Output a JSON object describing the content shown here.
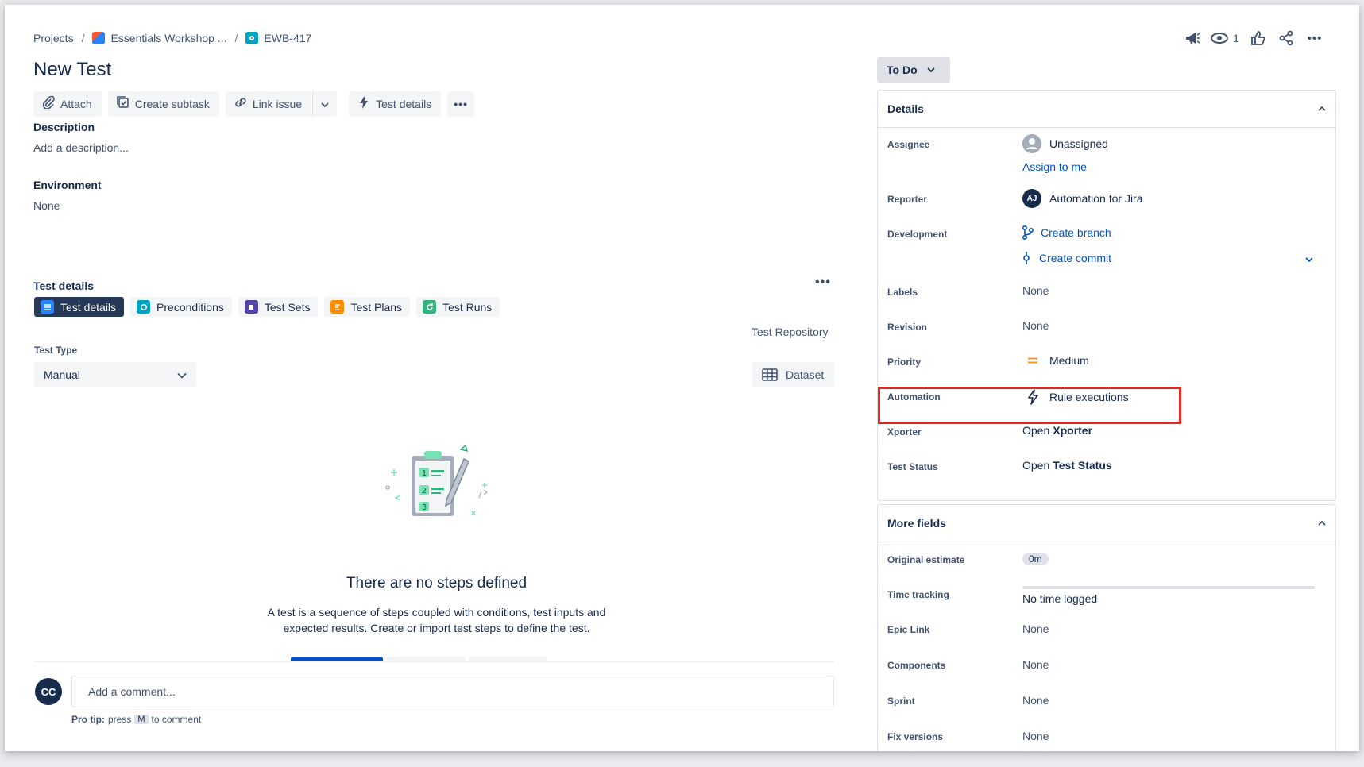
{
  "breadcrumb": {
    "root": "Projects",
    "project": "Essentials Workshop ...",
    "issue_key": "EWB-417",
    "sep": "/"
  },
  "title": "New Test",
  "toolbar": {
    "attach": "Attach",
    "create_subtask": "Create subtask",
    "link_issue": "Link issue",
    "test_details": "Test details"
  },
  "description": {
    "heading": "Description",
    "placeholder": "Add a description..."
  },
  "environment": {
    "heading": "Environment",
    "value": "None"
  },
  "test_details": {
    "heading": "Test details",
    "tabs": [
      "Test details",
      "Preconditions",
      "Test Sets",
      "Test Plans",
      "Test Runs"
    ],
    "repository_label": "Test Repository",
    "test_type_label": "Test Type",
    "test_type_value": "Manual",
    "dataset_label": "Dataset",
    "empty_title": "There are no steps defined",
    "empty_desc_line1": "A test is a sequence of steps coupled with conditions, test inputs and",
    "empty_desc_line2": "expected results. Create or import test steps to define the test."
  },
  "comment": {
    "avatar": "CC",
    "placeholder": "Add a comment...",
    "protip_label": "Pro tip:",
    "protip_press": "press",
    "protip_key": "M",
    "protip_suffix": "to comment"
  },
  "header_actions": {
    "watch_count": "1"
  },
  "status": "To Do",
  "details": {
    "heading": "Details",
    "assignee_label": "Assignee",
    "assignee_value": "Unassigned",
    "assign_to_me": "Assign to me",
    "reporter_label": "Reporter",
    "reporter_initials": "AJ",
    "reporter_value": "Automation for Jira",
    "development_label": "Development",
    "create_branch": "Create branch",
    "create_commit": "Create commit",
    "labels_label": "Labels",
    "labels_value": "None",
    "revision_label": "Revision",
    "revision_value": "None",
    "priority_label": "Priority",
    "priority_value": "Medium",
    "automation_label": "Automation",
    "automation_value": "Rule executions",
    "xporter_label": "Xporter",
    "xporter_open": "Open",
    "xporter_value": "Xporter",
    "test_status_label": "Test Status",
    "test_status_open": "Open",
    "test_status_value": "Test Status"
  },
  "more_fields": {
    "heading": "More fields",
    "original_estimate_label": "Original estimate",
    "original_estimate_value": "0m",
    "time_tracking_label": "Time tracking",
    "time_tracking_value": "No time logged",
    "epic_link_label": "Epic Link",
    "epic_link_value": "None",
    "components_label": "Components",
    "components_value": "None",
    "sprint_label": "Sprint",
    "sprint_value": "None",
    "fix_versions_label": "Fix versions",
    "fix_versions_value": "None"
  },
  "colors": {
    "highlight": "#e5261f",
    "link": "#0052cc",
    "active_tab": "#253858"
  }
}
